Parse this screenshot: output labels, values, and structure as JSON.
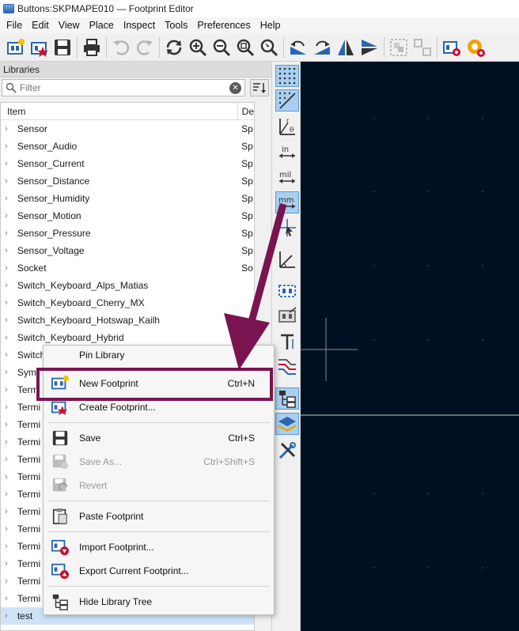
{
  "window": {
    "title": "Buttons:SKPMAPE010 — Footprint Editor"
  },
  "menubar": [
    "File",
    "Edit",
    "View",
    "Place",
    "Inspect",
    "Tools",
    "Preferences",
    "Help"
  ],
  "toolbar": {
    "icons": [
      "new-footprint-icon",
      "create-footprint-icon",
      "save-icon",
      "print-icon",
      "undo-icon",
      "redo-icon",
      "refresh-icon",
      "zoom-in-icon",
      "zoom-out-icon",
      "zoom-fit-icon",
      "zoom-selection-icon",
      "rotate-ccw-icon",
      "rotate-cw-icon",
      "mirror-h-icon",
      "mirror-v-icon",
      "group-icon",
      "ungroup-icon",
      "footprint-properties-icon",
      "pad-settings-icon"
    ]
  },
  "libraries": {
    "header": "Libraries",
    "filter_placeholder": "Filter",
    "columns": {
      "item": "Item",
      "desc": "De"
    },
    "rows": [
      {
        "name": "Sensor",
        "desc": "Sp"
      },
      {
        "name": "Sensor_Audio",
        "desc": "Sp"
      },
      {
        "name": "Sensor_Current",
        "desc": "Sp"
      },
      {
        "name": "Sensor_Distance",
        "desc": "Sp"
      },
      {
        "name": "Sensor_Humidity",
        "desc": "Sp"
      },
      {
        "name": "Sensor_Motion",
        "desc": "Sp"
      },
      {
        "name": "Sensor_Pressure",
        "desc": "Sp"
      },
      {
        "name": "Sensor_Voltage",
        "desc": "Sp"
      },
      {
        "name": "Socket",
        "desc": "So"
      },
      {
        "name": "Switch_Keyboard_Alps_Matias",
        "desc": ""
      },
      {
        "name": "Switch_Keyboard_Cherry_MX",
        "desc": ""
      },
      {
        "name": "Switch_Keyboard_Hotswap_Kailh",
        "desc": ""
      },
      {
        "name": "Switch_Keyboard_Hybrid",
        "desc": ""
      },
      {
        "name": "Switch",
        "desc": ""
      },
      {
        "name": "Sym",
        "desc": ""
      },
      {
        "name": "Term",
        "desc": ""
      },
      {
        "name": "Termi",
        "desc": ""
      },
      {
        "name": "Termi",
        "desc": ""
      },
      {
        "name": "Termi",
        "desc": ""
      },
      {
        "name": "Termi",
        "desc": ""
      },
      {
        "name": "Termi",
        "desc": ""
      },
      {
        "name": "Termi",
        "desc": ""
      },
      {
        "name": "Termi",
        "desc": ""
      },
      {
        "name": "Termi",
        "desc": ""
      },
      {
        "name": "Termi",
        "desc": ""
      },
      {
        "name": "Termi",
        "desc": ""
      },
      {
        "name": "Termi",
        "desc": ""
      },
      {
        "name": "Termi",
        "desc": ""
      },
      {
        "name": "test",
        "desc": ""
      }
    ]
  },
  "context_menu": {
    "partial_top": "Pin Library",
    "items": [
      {
        "label": "New Footprint",
        "shortcut": "Ctrl+N",
        "icon": "new-footprint-icon",
        "enabled": true
      },
      {
        "label": "Create Footprint...",
        "shortcut": "",
        "icon": "create-footprint-icon",
        "enabled": true
      },
      {
        "label": "Save",
        "shortcut": "Ctrl+S",
        "icon": "save-icon",
        "enabled": true
      },
      {
        "label": "Save As...",
        "shortcut": "Ctrl+Shift+S",
        "icon": "save-as-icon",
        "enabled": false
      },
      {
        "label": "Revert",
        "shortcut": "",
        "icon": "revert-icon",
        "enabled": false
      },
      {
        "label": "Paste Footprint",
        "shortcut": "",
        "icon": "paste-icon",
        "enabled": true
      },
      {
        "label": "Import Footprint...",
        "shortcut": "",
        "icon": "import-footprint-icon",
        "enabled": true
      },
      {
        "label": "Export Current Footprint...",
        "shortcut": "",
        "icon": "export-footprint-icon",
        "enabled": true
      },
      {
        "label": "Hide Library Tree",
        "shortcut": "",
        "icon": "library-tree-icon",
        "enabled": true
      }
    ]
  },
  "right_toolbar": {
    "unit_labels": {
      "in": "in",
      "mil": "mil",
      "mm": "mm"
    }
  },
  "colors": {
    "canvas": "#001023",
    "annotation": "#7a1450",
    "active_tool": "#a9cff0"
  }
}
